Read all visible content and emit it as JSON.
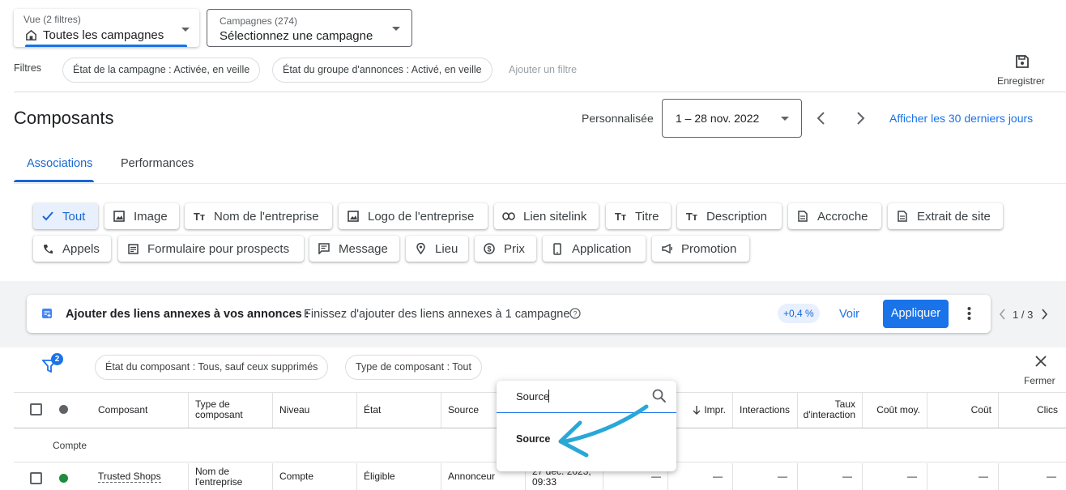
{
  "view_selector": {
    "label": "Vue (2 filtres)",
    "value": "Toutes les campagnes"
  },
  "campaign_selector": {
    "label": "Campagnes (274)",
    "value": "Sélectionnez une campagne"
  },
  "filters": {
    "label": "Filtres",
    "chips": [
      "État de la campagne : Activée, en veille",
      "État du groupe d'annonces : Activé, en veille"
    ],
    "add_filter": "Ajouter un filtre"
  },
  "save": {
    "label": "Enregistrer",
    "icon": "save-icon"
  },
  "page": {
    "title": "Composants"
  },
  "date_range": {
    "preset": "Personnalisée",
    "value": "1 – 28 nov. 2022",
    "last30": "Afficher les 30 derniers jours"
  },
  "tabs": [
    {
      "label": "Associations",
      "active": true
    },
    {
      "label": "Performances",
      "active": false
    }
  ],
  "asset_types": {
    "row1": [
      "Tout",
      "Image",
      "Nom de l'entreprise",
      "Logo de l'entreprise",
      "Lien sitelink",
      "Titre",
      "Description",
      "Accroche",
      "Extrait de site"
    ],
    "row2": [
      "Appels",
      "Formulaire pour prospects",
      "Message",
      "Lieu",
      "Prix",
      "Application",
      "Promotion"
    ]
  },
  "banner": {
    "title": "Ajouter des liens annexes à vos annonces :",
    "text": "Finissez d'ajouter des liens annexes à 1 campagne",
    "badge": "+0,4 %",
    "view": "Voir",
    "apply": "Appliquer",
    "pager": "1 / 3"
  },
  "table_filters": {
    "count": "2",
    "chips": [
      "État du composant : Tous, sauf ceux supprimés",
      "Type de composant : Tout"
    ],
    "close": "Fermer"
  },
  "column_search": {
    "value": "Source",
    "result": "Source"
  },
  "table": {
    "headers": [
      "Composant",
      "Type de composant",
      "Niveau",
      "État",
      "Source",
      "Impr.",
      "Interactions",
      "Taux d'interaction",
      "Coût moy.",
      "Coût",
      "Clics"
    ],
    "group_label": "Compte",
    "row": {
      "asset": "Trusted Shops",
      "type": "Nom de l'entreprise",
      "level": "Compte",
      "status": "Éligible",
      "source": "Annonceur",
      "date": "27 déc. 2023, 09:33",
      "dash": "—"
    }
  },
  "colors": {
    "accent": "#1a73e8",
    "active_tab": "#1967d2",
    "status_green": "#1e8e3e",
    "arrow": "#29a8d8"
  }
}
